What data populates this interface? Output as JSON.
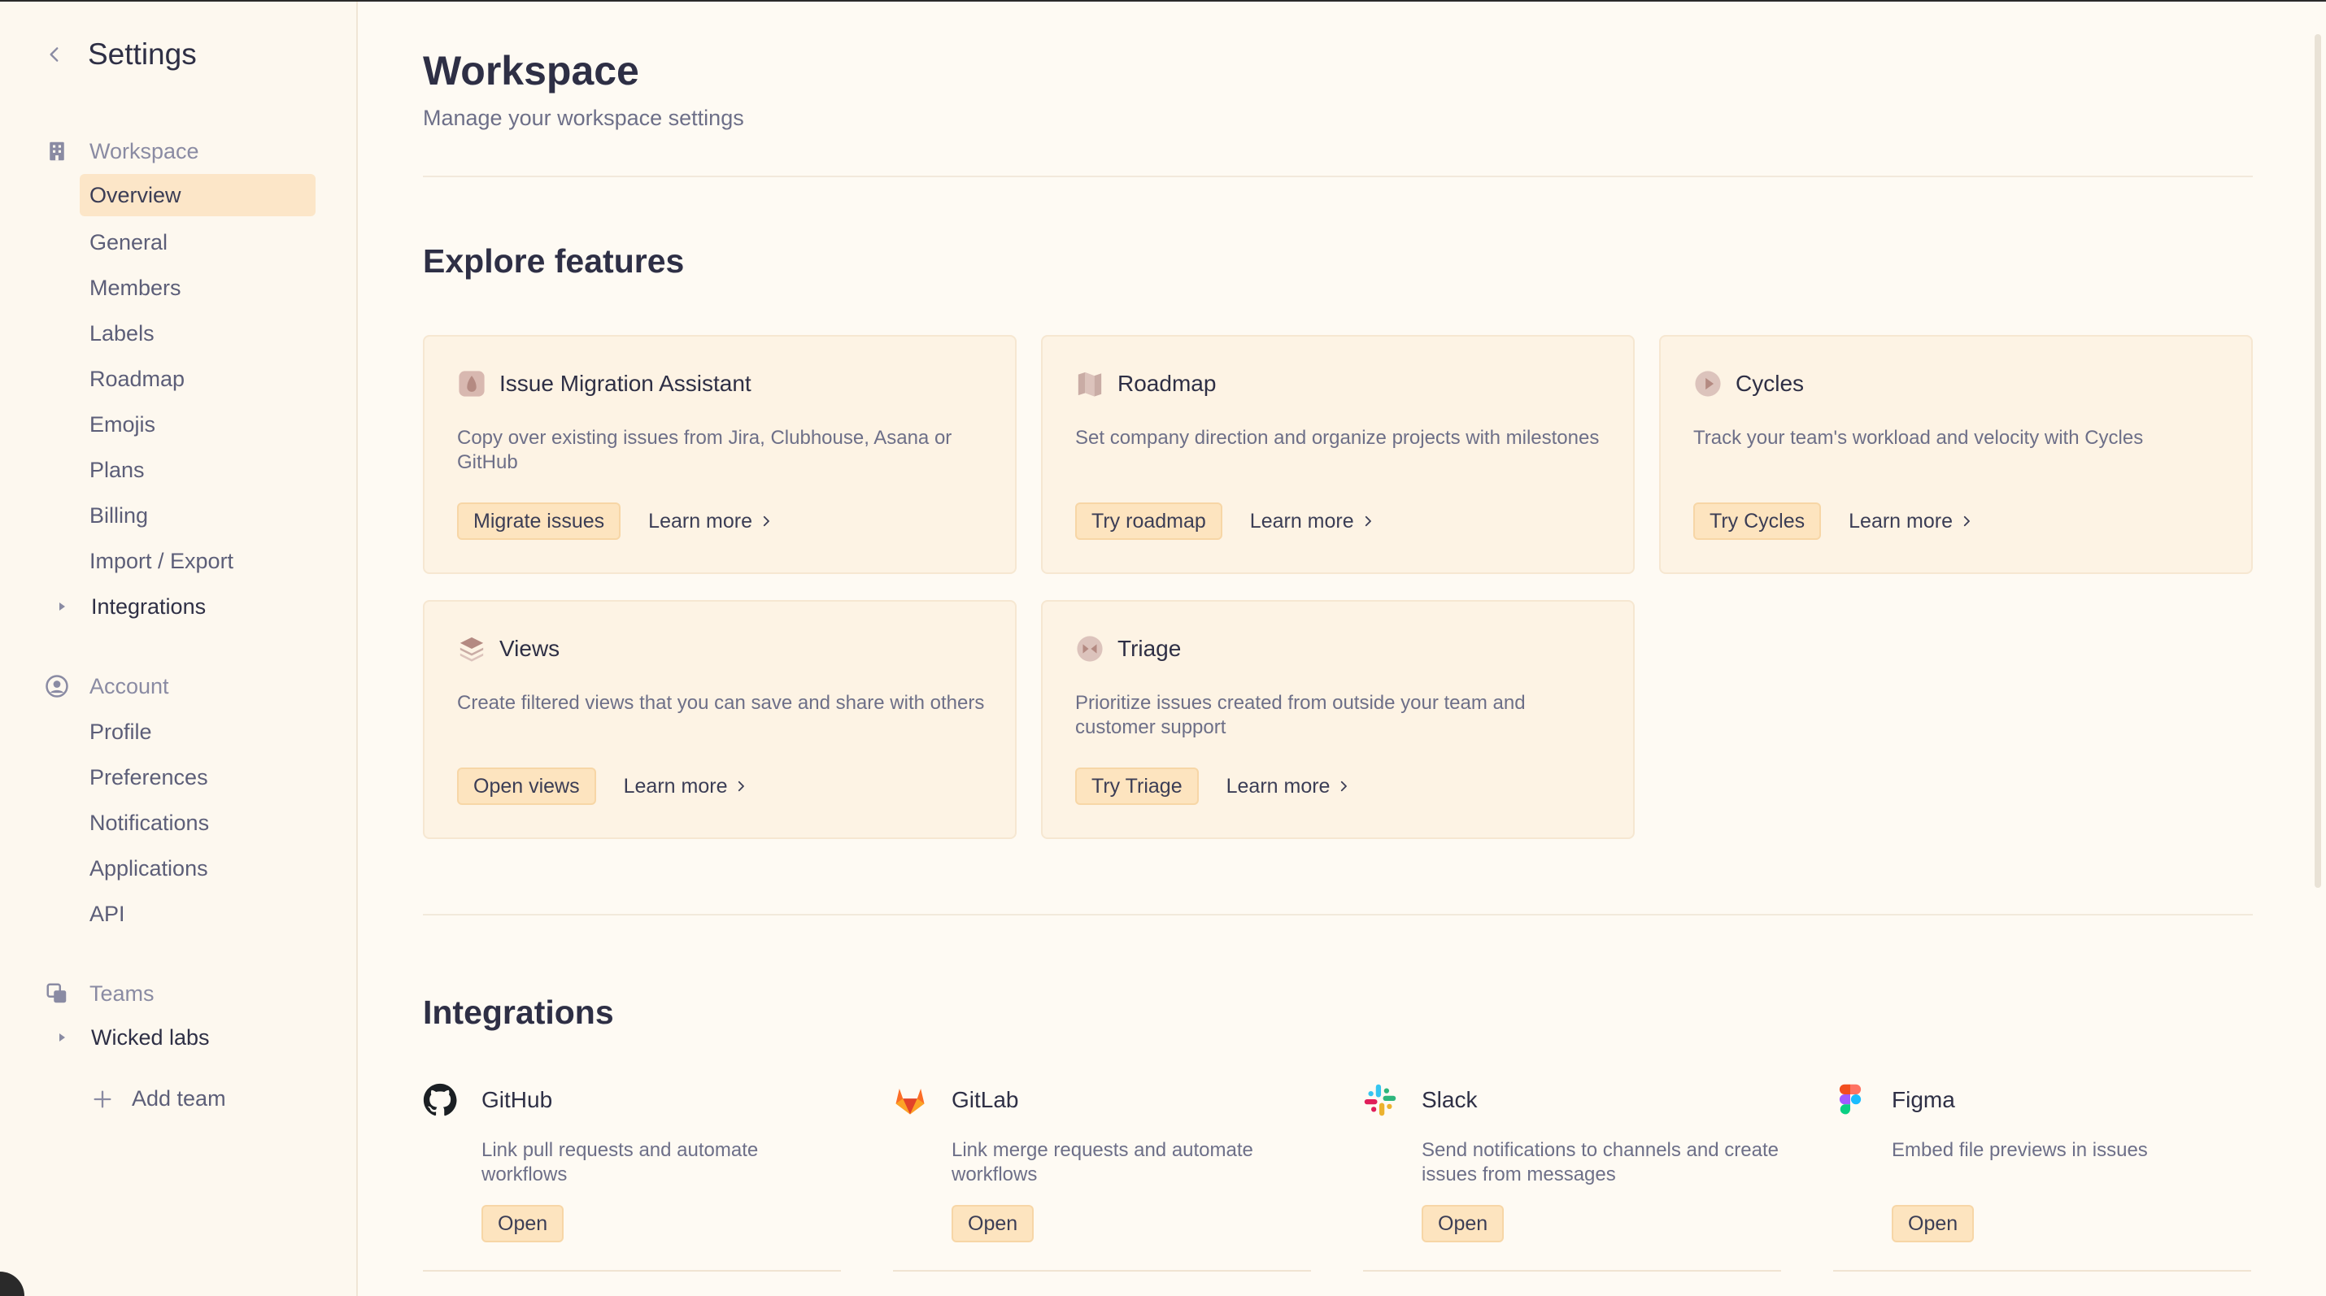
{
  "sidebar": {
    "title": "Settings",
    "workspace_label": "Workspace",
    "workspace_items": [
      "Overview",
      "General",
      "Members",
      "Labels",
      "Roadmap",
      "Emojis",
      "Plans",
      "Billing",
      "Import / Export"
    ],
    "integrations_label": "Integrations",
    "account_label": "Account",
    "account_items": [
      "Profile",
      "Preferences",
      "Notifications",
      "Applications",
      "API"
    ],
    "teams_label": "Teams",
    "team_name": "Wicked labs",
    "add_team": "Add team"
  },
  "header": {
    "title": "Workspace",
    "subtitle": "Manage your workspace settings"
  },
  "explore": {
    "title": "Explore features",
    "cards": [
      {
        "title": "Issue Migration Assistant",
        "desc": "Copy over existing issues from Jira, Clubhouse, Asana or GitHub",
        "action": "Migrate issues",
        "learn": "Learn more",
        "icon": "migration-icon"
      },
      {
        "title": "Roadmap",
        "desc": "Set company direction and organize projects with milestones",
        "action": "Try roadmap",
        "learn": "Learn more",
        "icon": "map-icon"
      },
      {
        "title": "Cycles",
        "desc": "Track your team's workload and velocity with Cycles",
        "action": "Try Cycles",
        "learn": "Learn more",
        "icon": "cycles-icon"
      },
      {
        "title": "Views",
        "desc": "Create filtered views that you can save and share with others",
        "action": "Open views",
        "learn": "Learn more",
        "icon": "layers-icon"
      },
      {
        "title": "Triage",
        "desc": "Prioritize issues created from outside your team and customer support",
        "action": "Try Triage",
        "learn": "Learn more",
        "icon": "triage-icon"
      }
    ]
  },
  "integrations": {
    "title": "Integrations",
    "items": [
      {
        "name": "GitHub",
        "desc": "Link pull requests and automate workflows",
        "action": "Open",
        "icon": "github-icon"
      },
      {
        "name": "GitLab",
        "desc": "Link merge requests and automate workflows",
        "action": "Open",
        "icon": "gitlab-icon"
      },
      {
        "name": "Slack",
        "desc": "Send notifications to channels and create issues from messages",
        "action": "Open",
        "icon": "slack-icon"
      },
      {
        "name": "Figma",
        "desc": "Embed file previews in issues",
        "action": "Open",
        "icon": "figma-icon"
      }
    ]
  },
  "colors": {
    "background": "#fefaf3",
    "sidebar_active": "#fce6c8",
    "card_background": "#fdf3e4",
    "button_background": "#fde4bf"
  }
}
